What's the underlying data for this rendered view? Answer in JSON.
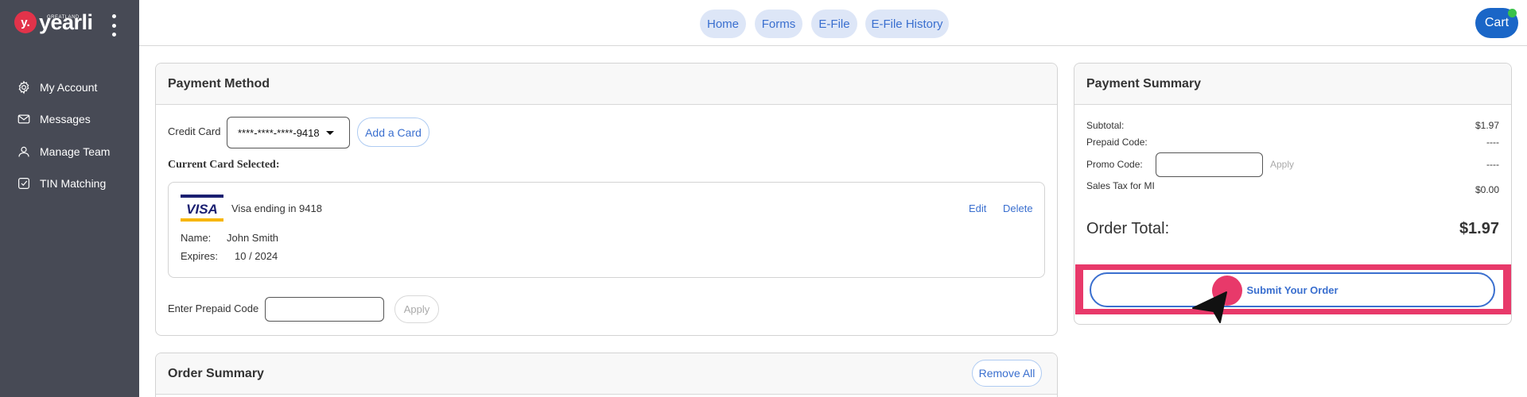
{
  "brand": {
    "badge": "y.",
    "name": "yearli",
    "tagline": "GREATLAND"
  },
  "sidebar": {
    "items": [
      {
        "label": "My Account",
        "icon": "gear-icon"
      },
      {
        "label": "Messages",
        "icon": "envelope-icon"
      },
      {
        "label": "Manage Team",
        "icon": "user-icon"
      },
      {
        "label": "TIN Matching",
        "icon": "check-square-icon"
      }
    ]
  },
  "topnav": {
    "tabs": [
      "Home",
      "Forms",
      "E-File",
      "E-File History"
    ],
    "cart_label": "Cart"
  },
  "payment_method": {
    "title": "Payment Method",
    "credit_card_label": "Credit Card",
    "selected_card": "****-****-****-9418",
    "add_card_label": "Add a Card",
    "current_card_heading": "Current Card Selected:",
    "card": {
      "brand": "VISA",
      "description": "Visa ending in 9418",
      "name_label": "Name:",
      "name_value": "John Smith",
      "expires_label": "Expires:",
      "expires_value": "10 / 2024",
      "edit_label": "Edit",
      "delete_label": "Delete"
    },
    "prepaid_label": "Enter Prepaid Code",
    "prepaid_value": "",
    "apply_label": "Apply"
  },
  "order_summary": {
    "title": "Order Summary",
    "remove_all_label": "Remove All"
  },
  "payment_summary": {
    "title": "Payment Summary",
    "subtotal_label": "Subtotal:",
    "subtotal_value": "$1.97",
    "prepaid_label": "Prepaid Code:",
    "prepaid_value": "----",
    "promo_label": "Promo Code:",
    "promo_value": "",
    "promo_apply_label": "Apply",
    "promo_amount": "----",
    "tax_label": "Sales Tax for MI",
    "tax_value": "$0.00",
    "total_label": "Order Total:",
    "total_value": "$1.97",
    "submit_label": "Submit Your Order"
  },
  "colors": {
    "sidebar_bg": "#474a55",
    "accent": "#3a6fcf",
    "highlight": "#e8396a",
    "cart_bg": "#1a66c7",
    "brand_red": "#e2334a"
  }
}
